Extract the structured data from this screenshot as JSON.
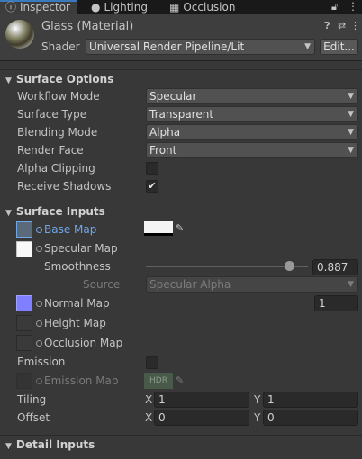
{
  "tabs": [
    {
      "label": "Inspector",
      "icon": "info-icon",
      "active": true
    },
    {
      "label": "Lighting",
      "icon": "lightbulb-icon",
      "active": false
    },
    {
      "label": "Occlusion",
      "icon": "occlusion-icon",
      "active": false
    }
  ],
  "header": {
    "material_name": "Glass (Material)",
    "shader_label": "Shader",
    "shader_value": "Universal Render Pipeline/Lit",
    "edit_label": "Edit..."
  },
  "surface_options": {
    "title": "Surface Options",
    "workflow_mode": {
      "label": "Workflow Mode",
      "value": "Specular"
    },
    "surface_type": {
      "label": "Surface Type",
      "value": "Transparent"
    },
    "blending_mode": {
      "label": "Blending Mode",
      "value": "Alpha"
    },
    "render_face": {
      "label": "Render Face",
      "value": "Front"
    },
    "alpha_clipping": {
      "label": "Alpha Clipping",
      "checked": false
    },
    "receive_shadows": {
      "label": "Receive Shadows",
      "checked": true
    }
  },
  "surface_inputs": {
    "title": "Surface Inputs",
    "base_map": {
      "label": "Base Map",
      "color": "#f4f4f4"
    },
    "specular_map": {
      "label": "Specular Map"
    },
    "smoothness": {
      "label": "Smoothness",
      "value": "0.887",
      "fraction": 0.887
    },
    "source": {
      "label": "Source",
      "value": "Specular Alpha"
    },
    "normal_map": {
      "label": "Normal Map",
      "value": "1",
      "thumb_color": "#7f7fff"
    },
    "height_map": {
      "label": "Height Map"
    },
    "occlusion_map": {
      "label": "Occlusion Map"
    },
    "emission": {
      "label": "Emission",
      "checked": false
    },
    "emission_map": {
      "label": "Emission Map",
      "badge": "HDR"
    },
    "tiling": {
      "label": "Tiling",
      "x_label": "X",
      "x": "1",
      "y_label": "Y",
      "y": "1"
    },
    "offset": {
      "label": "Offset",
      "x_label": "X",
      "x": "0",
      "y_label": "Y",
      "y": "0"
    }
  },
  "detail_inputs": {
    "title": "Detail Inputs"
  },
  "colors": {
    "accent_blue": "#3a79bb",
    "link_blue": "#6fa6e6",
    "background": "#383838"
  }
}
